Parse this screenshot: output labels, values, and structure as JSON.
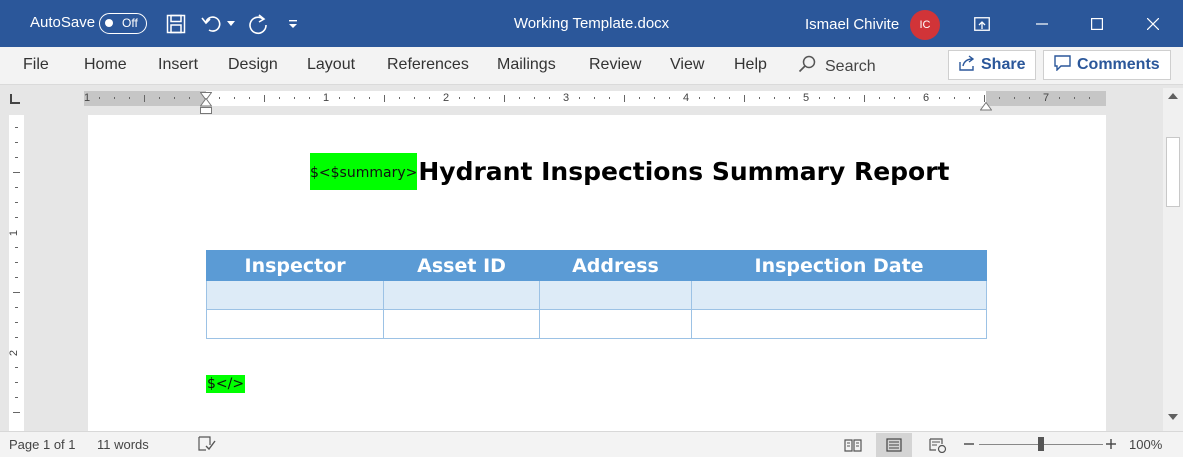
{
  "titlebar": {
    "autosave_label": "AutoSave",
    "autosave_state": "Off",
    "document_title": "Working Template.docx",
    "user_name": "Ismael Chivite",
    "user_initials": "IC"
  },
  "ribbon": {
    "tabs": [
      "File",
      "Home",
      "Insert",
      "Design",
      "Layout",
      "References",
      "Mailings",
      "Review",
      "View",
      "Help"
    ],
    "search_label": "Search",
    "share_label": "Share",
    "comments_label": "Comments"
  },
  "ruler": {
    "h_numbers": [
      "1",
      "1",
      "2",
      "3",
      "4",
      "5",
      "6",
      "7"
    ],
    "v_numbers": [
      "1",
      "2"
    ]
  },
  "document": {
    "open_tag": "$<$summary>",
    "heading": "Hydrant Inspections Summary Report",
    "close_tag": "$</>",
    "table": {
      "headers": [
        "Inspector",
        "Asset ID",
        "Address",
        "Inspection Date"
      ],
      "rows": [
        [
          "",
          "",
          "",
          ""
        ],
        [
          "",
          "",
          "",
          ""
        ]
      ]
    }
  },
  "statusbar": {
    "page_info": "Page 1 of 1",
    "word_count": "11 words",
    "zoom": "100%"
  },
  "colors": {
    "titlebar": "#2b579a",
    "highlight": "#00ff00",
    "table_header": "#5b9bd5",
    "table_band": "#ddebf7",
    "avatar": "#d13438"
  }
}
